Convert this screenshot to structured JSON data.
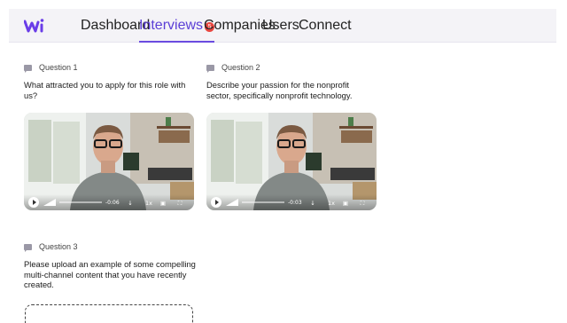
{
  "nav": {
    "items": [
      {
        "label": "Dashboard"
      },
      {
        "label": "Interviews",
        "badge": "5",
        "active": true
      },
      {
        "label": "Companies"
      },
      {
        "label": "Users"
      },
      {
        "label": "Connect"
      }
    ]
  },
  "questions": [
    {
      "heading": "Question 1",
      "text": "What attracted you to apply for this role with us?",
      "video": {
        "time": "-0:06",
        "speed": "1x"
      }
    },
    {
      "heading": "Question 2",
      "text": "Describe your passion for the nonprofit sector, specifically nonprofit technology.",
      "video": {
        "time": "-0:03",
        "speed": "1x"
      }
    },
    {
      "heading": "Question 3",
      "text": "Please upload an example of some compelling multi-channel content that you have recently created."
    }
  ],
  "colors": {
    "accent": "#6a4be0",
    "badge": "#e8463f",
    "topbar": "#f4f3f7"
  }
}
